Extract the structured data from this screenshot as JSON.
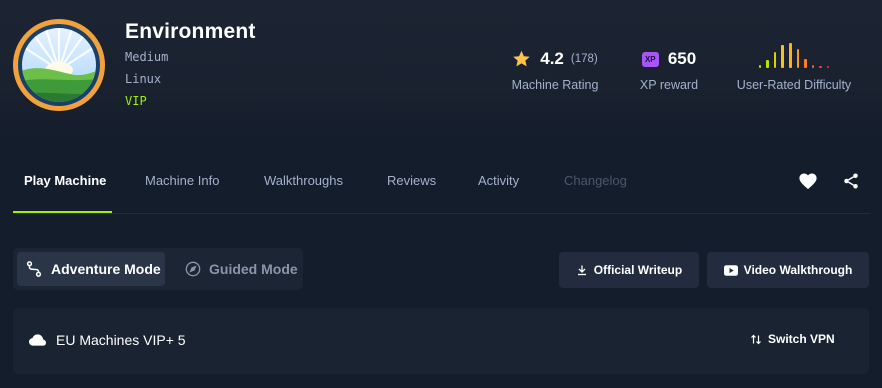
{
  "machine": {
    "name": "Environment",
    "difficulty": "Medium",
    "os": "Linux",
    "tier": "VIP",
    "avatar_icon": "landscape-logo"
  },
  "stats": {
    "rating_value": "4.2",
    "rating_count": "(178)",
    "rating_label": "Machine Rating",
    "xp_badge": "XP",
    "xp_value": "650",
    "xp_label": "XP reward",
    "difficulty_label": "User-Rated Difficulty",
    "difficulty_bars": [
      0.13,
      0.3,
      0.62,
      0.9,
      0.95,
      0.74,
      0.35,
      0.1,
      0.08,
      0.08
    ]
  },
  "tabs": [
    {
      "label": "Play Machine",
      "state": "active"
    },
    {
      "label": "Machine Info",
      "state": "normal"
    },
    {
      "label": "Walkthroughs",
      "state": "normal"
    },
    {
      "label": "Reviews",
      "state": "normal"
    },
    {
      "label": "Activity",
      "state": "normal"
    },
    {
      "label": "Changelog",
      "state": "disabled"
    }
  ],
  "modes": {
    "adventure": "Adventure Mode",
    "guided": "Guided Mode"
  },
  "actions": {
    "writeup": "Official Writeup",
    "video": "Video Walkthrough"
  },
  "vpn": {
    "server": "EU Machines VIP+ 5",
    "switch_label": "Switch VPN"
  },
  "colors": {
    "accent": "#9fef00",
    "background": "#141d2b",
    "star": "#ffc24a",
    "xp": "#a855f7",
    "muted": "#a4b1cd"
  }
}
